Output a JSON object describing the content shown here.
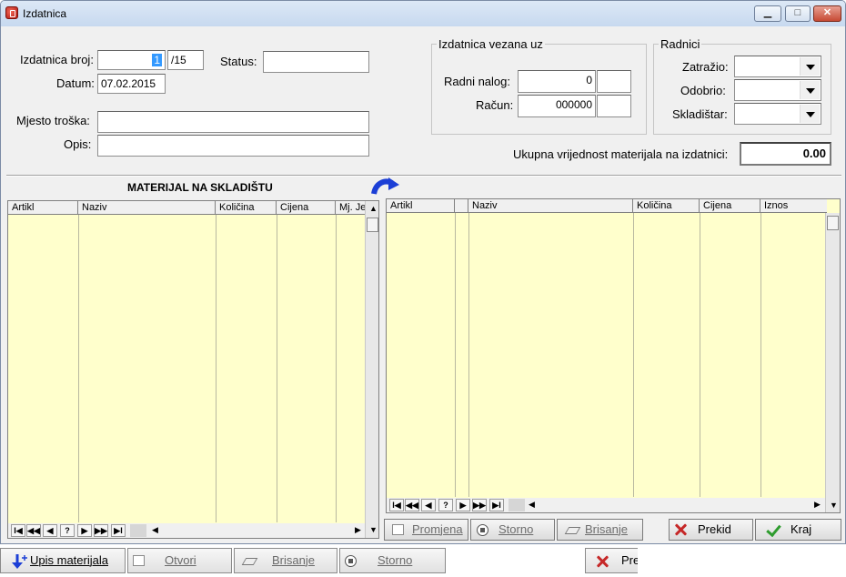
{
  "window": {
    "title": "Izdatnica",
    "minimize": "▁",
    "maximize": "□",
    "close": "✕"
  },
  "header": {
    "broj_label": "Izdatnica broj:",
    "broj_value": "1",
    "broj_suffix": "/15",
    "datum_label": "Datum:",
    "datum_value": "07.02.2015",
    "status_label": "Status:",
    "status_value": "",
    "mjesto_label": "Mjesto troška:",
    "mjesto_value": "",
    "opis_label": "Opis:",
    "opis_value": ""
  },
  "vezana": {
    "title": "Izdatnica vezana uz",
    "nalog_label": "Radni nalog:",
    "nalog_value": "0",
    "nalog_extra": "",
    "racun_label": "Račun:",
    "racun_value": "000000",
    "racun_extra": ""
  },
  "radnici": {
    "title": "Radnici",
    "zatrazio_label": "Zatražio:",
    "odobrio_label": "Odobrio:",
    "skladistar_label": "Skladištar:"
  },
  "total": {
    "label": "Ukupna vrijednost materijala na izdatnici:",
    "value": "0.00"
  },
  "left_grid": {
    "title": "MATERIJAL NA SKLADIŠTU",
    "columns": [
      "Artikl",
      "Naziv",
      "Količina",
      "Cijena",
      "Mj. Je"
    ]
  },
  "right_grid": {
    "columns": [
      "Artikl",
      "",
      "Naziv",
      "Količina",
      "Cijena",
      "Iznos"
    ]
  },
  "nav": [
    "I◀",
    "◀◀",
    "◀",
    "?",
    "▶",
    "▶▶",
    "▶I"
  ],
  "buttons": {
    "promjena": "Promjena",
    "storno": "Storno",
    "brisanje": "Brisanje",
    "prekid": "Prekid",
    "kraj": "Kraj"
  },
  "bottom": {
    "upis": "Upis materijala",
    "otvori": "Otvori",
    "brisanje": "Brisanje",
    "storno": "Storno",
    "prekid_partial": "Pre"
  }
}
